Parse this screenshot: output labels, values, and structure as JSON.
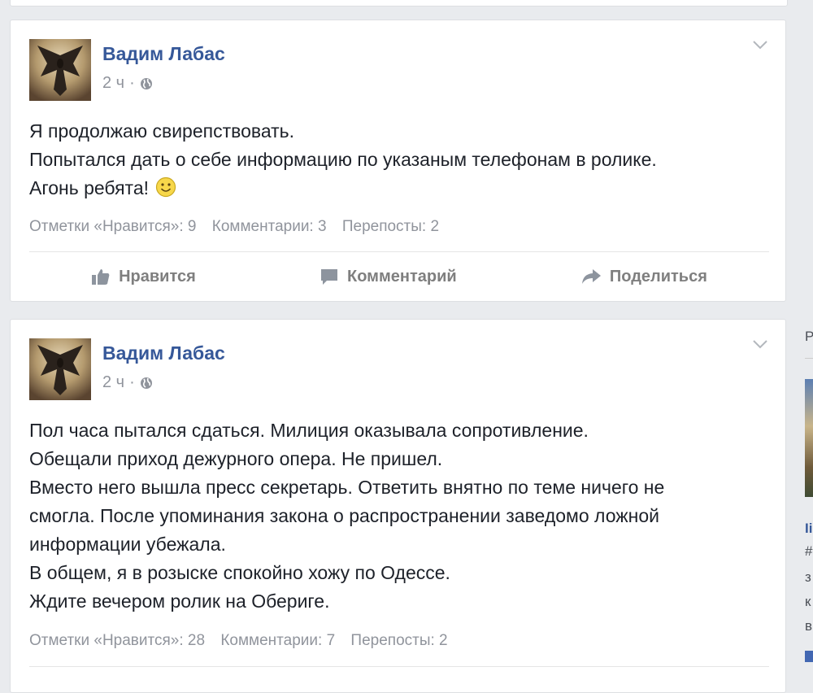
{
  "posts": [
    {
      "author": "Вадим Лабас",
      "time": "2 ч",
      "dot": "·",
      "lines": [
        "Я продолжаю свирепствовать.",
        "Попытался дать о себе информацию по указаным телефонам в ролике.",
        "Агонь ребята!"
      ],
      "likes": "Отметки «Нравится»: 9",
      "comments": "Комментарии: 3",
      "shares": "Перепосты: 2"
    },
    {
      "author": "Вадим Лабас",
      "time": "2 ч",
      "dot": "·",
      "lines": [
        "Пол часа пытался сдаться. Милиция оказывала сопротивление.",
        "Обещали приход дежурного опера. Не пришел.",
        "Вместо него вышла пресс секретарь. Ответить внятно по теме ничего не",
        "смогла. После упоминания закона о распространении заведомо ложной",
        "информации убежала.",
        "В общем, я в розыске спокойно хожу по Одессе.",
        "Ждите вечером ролик на Обериге."
      ],
      "likes": "Отметки «Нравится»: 28",
      "comments": "Комментарии: 7",
      "shares": "Перепосты: 2"
    }
  ],
  "actions": {
    "like": "Нравится",
    "comment": "Комментарий",
    "share": "Поделиться"
  },
  "right_column": {
    "letter_p": "Р",
    "title": "Ii",
    "lines": [
      "#",
      "з",
      "к",
      "в"
    ]
  },
  "colors": {
    "author": "#365899",
    "meta": "#90949c",
    "action": "#7f7f7f",
    "background": "#e9ebee"
  },
  "icons": [
    "globe-icon",
    "chevron-down-icon",
    "smiley-icon",
    "like-icon",
    "comment-icon",
    "share-icon"
  ]
}
